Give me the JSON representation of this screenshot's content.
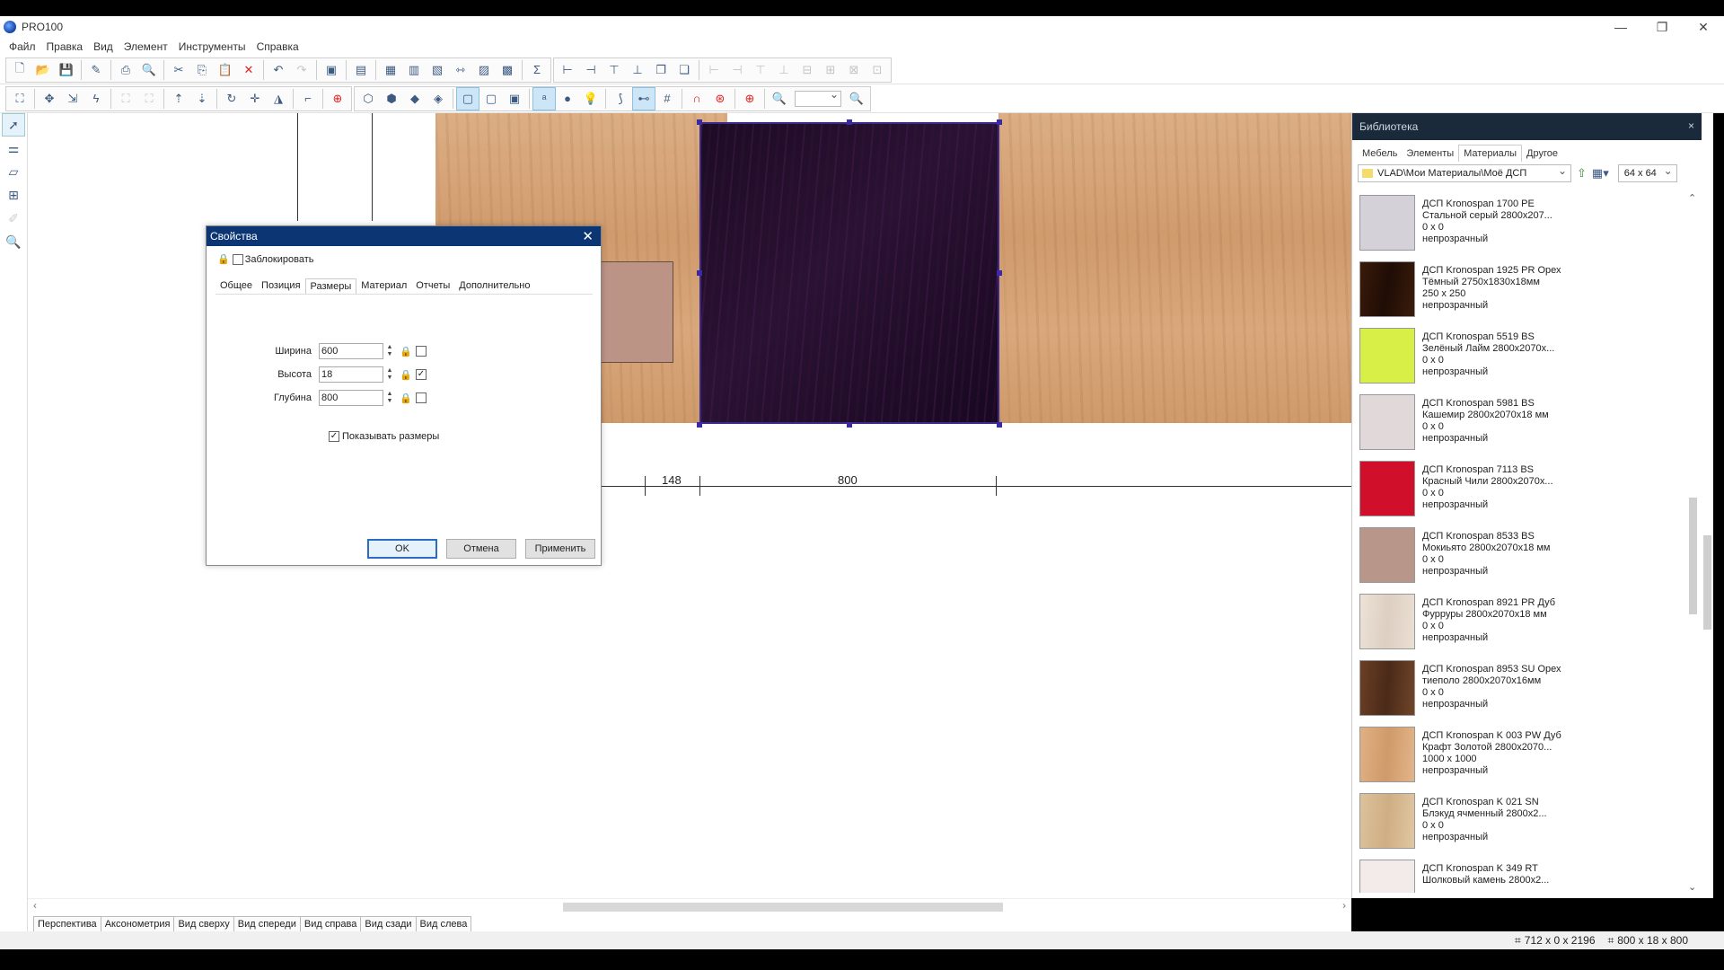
{
  "window": {
    "title": "PRO100",
    "minimize": "—",
    "maximize": "❐",
    "close": "✕"
  },
  "menu": [
    "Файл",
    "Правка",
    "Вид",
    "Элемент",
    "Инструменты",
    "Справка"
  ],
  "canvas": {
    "dim_labels": [
      "148",
      "800"
    ]
  },
  "view_tabs": [
    "Перспектива",
    "Аксонометрия",
    "Вид сверху",
    "Вид спереди",
    "Вид справа",
    "Вид сзади",
    "Вид слева"
  ],
  "status": {
    "size_scene": "712 x 0 x 2196",
    "size_element": "800 x 18 x 800"
  },
  "library": {
    "title": "Библиотека",
    "close": "×",
    "tabs": [
      "Мебель",
      "Элементы",
      "Материалы",
      "Другое"
    ],
    "selected_tab": "Материалы",
    "path": "VLAD\\Мои Материалы\\Моё ДСП",
    "thumb_size": "64 x 64",
    "items": [
      {
        "line1": "ДСП Kronospan 1700 PE",
        "line2": "Стальной серый 2800х207...",
        "line3": "0 x 0",
        "line4": "непрозрачный",
        "color": "#d4d1d8"
      },
      {
        "line1": "ДСП Kronospan 1925 PR Орех",
        "line2": "Тёмный 2750х1830х18мм",
        "line3": "250 x 250",
        "line4": "непрозрачный",
        "color": "#2d1408"
      },
      {
        "line1": "ДСП Kronospan 5519 BS",
        "line2": "Зелёный Лайм 2800х2070х...",
        "line3": "0 x 0",
        "line4": "непрозрачный",
        "color": "#d8ef48"
      },
      {
        "line1": "ДСП Kronospan 5981 BS",
        "line2": "Кашемир 2800х2070х18 мм",
        "line3": "0 x 0",
        "line4": "непрозрачный",
        "color": "#e1d9d9"
      },
      {
        "line1": "ДСП Kronospan 7113 BS",
        "line2": "Красный Чили 2800х2070х...",
        "line3": "0 x 0",
        "line4": "непрозрачный",
        "color": "#d0102a"
      },
      {
        "line1": "ДСП Kronospan 8533 BS",
        "line2": "Мокиьято 2800х2070х18 мм",
        "line3": "0 x 0",
        "line4": "непрозрачный",
        "color": "#b8968a"
      },
      {
        "line1": "ДСП Kronospan 8921 PR Дуб",
        "line2": "Фурруры 2800х2070х18 мм",
        "line3": "0 x 0",
        "line4": "непрозрачный",
        "color": "#e6d9cc"
      },
      {
        "line1": "ДСП Kronospan 8953 SU Орех",
        "line2": "тиеполо 2800х2070х16мм",
        "line3": "0 x 0",
        "line4": "непрозрачный",
        "color": "#5d3520"
      },
      {
        "line1": "ДСП Kronospan K 003 PW Дуб",
        "line2": "Крафт Золотой 2800х2070...",
        "line3": "1000 x 1000",
        "line4": "непрозрачный",
        "color": "#dba87b"
      },
      {
        "line1": "ДСП Kronospan K 021 SN",
        "line2": "Блэкуд ячменный 2800х2...",
        "line3": "0 x 0",
        "line4": "непрозрачный",
        "color": "#d8b992"
      },
      {
        "line1": "ДСП Kronospan K 349 RT",
        "line2": "Шолковый камень 2800х2...",
        "line3": "",
        "line4": "",
        "color": "#f3ebea"
      }
    ]
  },
  "dialog": {
    "title": "Свойства",
    "lock_label": "Заблокировать",
    "tabs": [
      "Общее",
      "Позиция",
      "Размеры",
      "Материал",
      "Отчеты",
      "Дополнительно"
    ],
    "selected_tab": "Размеры",
    "fields": [
      {
        "label": "Ширина",
        "value": "600",
        "checked": false
      },
      {
        "label": "Высота",
        "value": "18",
        "checked": true
      },
      {
        "label": "Глубина",
        "value": "800",
        "checked": false
      }
    ],
    "show_dims_label": "Показывать размеры",
    "show_dims_checked": true,
    "ok": "OK",
    "cancel": "Отмена",
    "apply": "Применить"
  },
  "colors": {
    "title_blue": "#0c3673",
    "library_header": "#1b2a3a",
    "selection": "#3a2aa8"
  }
}
